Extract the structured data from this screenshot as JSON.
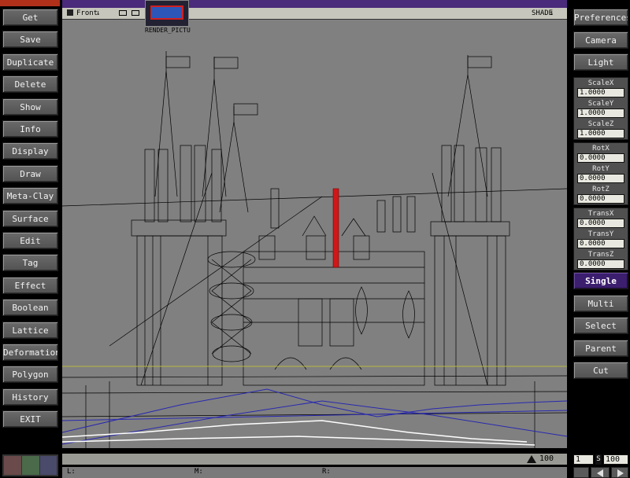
{
  "left_menu": [
    "Get",
    "Save",
    "Duplicate",
    "Delete",
    "Show",
    "Info",
    "Display",
    "Draw",
    "Meta-Clay",
    "Surface",
    "Edit",
    "Tag",
    "Effect",
    "Boolean",
    "Lattice",
    "Deformation",
    "Polygon",
    "History",
    "EXIT"
  ],
  "viewport": {
    "view_label": "Front",
    "shade_label": "SHADE",
    "thumbnail_label": "RENDER_PICTU"
  },
  "right_top": [
    "Preferences",
    "Camera",
    "Light"
  ],
  "scale": [
    {
      "label": "ScaleX",
      "value": "1.0000"
    },
    {
      "label": "ScaleY",
      "value": "1.0000"
    },
    {
      "label": "ScaleZ",
      "value": "1.0000"
    }
  ],
  "rot": [
    {
      "label": "RotX",
      "value": "0.0000"
    },
    {
      "label": "RotY",
      "value": "0.0000"
    },
    {
      "label": "RotZ",
      "value": "0.0000"
    }
  ],
  "trans": [
    {
      "label": "TransX",
      "value": "0.0000"
    },
    {
      "label": "TransY",
      "value": "0.0000"
    },
    {
      "label": "TransZ",
      "value": "0.0000"
    }
  ],
  "right_modes": [
    {
      "label": "Single",
      "active": true
    },
    {
      "label": "Multi",
      "active": false
    },
    {
      "label": "Select",
      "active": false
    },
    {
      "label": "Parent",
      "active": false
    },
    {
      "label": "Cut",
      "active": false
    }
  ],
  "status": {
    "zoom_value": "100",
    "frame_value": "1",
    "end_value": "100",
    "l_label": "L:",
    "m_label": "M:",
    "r_label": "R:"
  },
  "colors": {
    "selected_object": "#d01818",
    "ground_lines": "#2828b0",
    "horizon_line": "#b8b840",
    "active_button": "#3c1e6e",
    "top_bar": "#4a2a7a"
  }
}
